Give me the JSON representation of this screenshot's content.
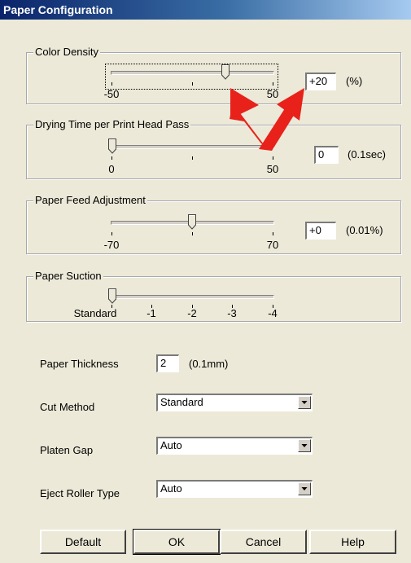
{
  "window": {
    "title": "Paper Configuration"
  },
  "color_density": {
    "label": "Color Density",
    "min_label": "-50",
    "max_label": "50",
    "value": "+20",
    "unit": "(%)",
    "slider_position_fraction": 0.7
  },
  "drying_time": {
    "label": "Drying Time per Print Head Pass",
    "min_label": "0",
    "max_label": "50",
    "value": "0",
    "unit": "(0.1sec)",
    "slider_position_fraction": 0.0
  },
  "paper_feed": {
    "label": "Paper Feed Adjustment",
    "min_label": "-70",
    "max_label": "70",
    "value": "+0",
    "unit": "(0.01%)",
    "slider_position_fraction": 0.5
  },
  "paper_suction": {
    "label": "Paper Suction",
    "ticks": [
      "Standard",
      "-1",
      "-2",
      "-3",
      "-4"
    ],
    "slider_position_fraction": 0.0
  },
  "paper_thickness": {
    "label": "Paper Thickness",
    "value": "2",
    "unit": "(0.1mm)"
  },
  "cut_method": {
    "label": "Cut Method",
    "value": "Standard"
  },
  "platen_gap": {
    "label": "Platen Gap",
    "value": "Auto"
  },
  "eject_roller": {
    "label": "Eject Roller Type",
    "value": "Auto"
  },
  "buttons": {
    "default": "Default",
    "ok": "OK",
    "cancel": "Cancel",
    "help": "Help"
  },
  "annotation": {
    "arrow_color": "#e8211a"
  }
}
